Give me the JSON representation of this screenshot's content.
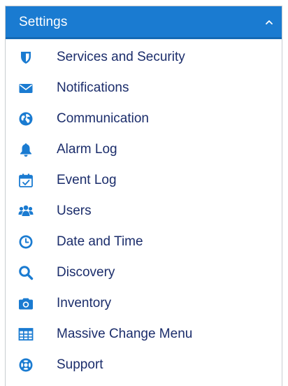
{
  "settings": {
    "title": "Settings",
    "accent_color": "#1a7bd1",
    "icon_color": "#1a7bd1",
    "label_color": "#1b2d6b",
    "collapse_icon": "chevron-up-icon",
    "items": [
      {
        "label": "Services and Security",
        "icon": "shield-icon"
      },
      {
        "label": "Notifications",
        "icon": "envelope-icon"
      },
      {
        "label": "Communication",
        "icon": "globe-icon"
      },
      {
        "label": "Alarm Log",
        "icon": "bell-icon"
      },
      {
        "label": "Event Log",
        "icon": "calendar-check-icon"
      },
      {
        "label": "Users",
        "icon": "users-icon"
      },
      {
        "label": "Date and Time",
        "icon": "clock-icon"
      },
      {
        "label": "Discovery",
        "icon": "search-icon"
      },
      {
        "label": "Inventory",
        "icon": "camera-icon"
      },
      {
        "label": "Massive Change Menu",
        "icon": "table-icon"
      },
      {
        "label": "Support",
        "icon": "life-ring-icon"
      }
    ]
  }
}
